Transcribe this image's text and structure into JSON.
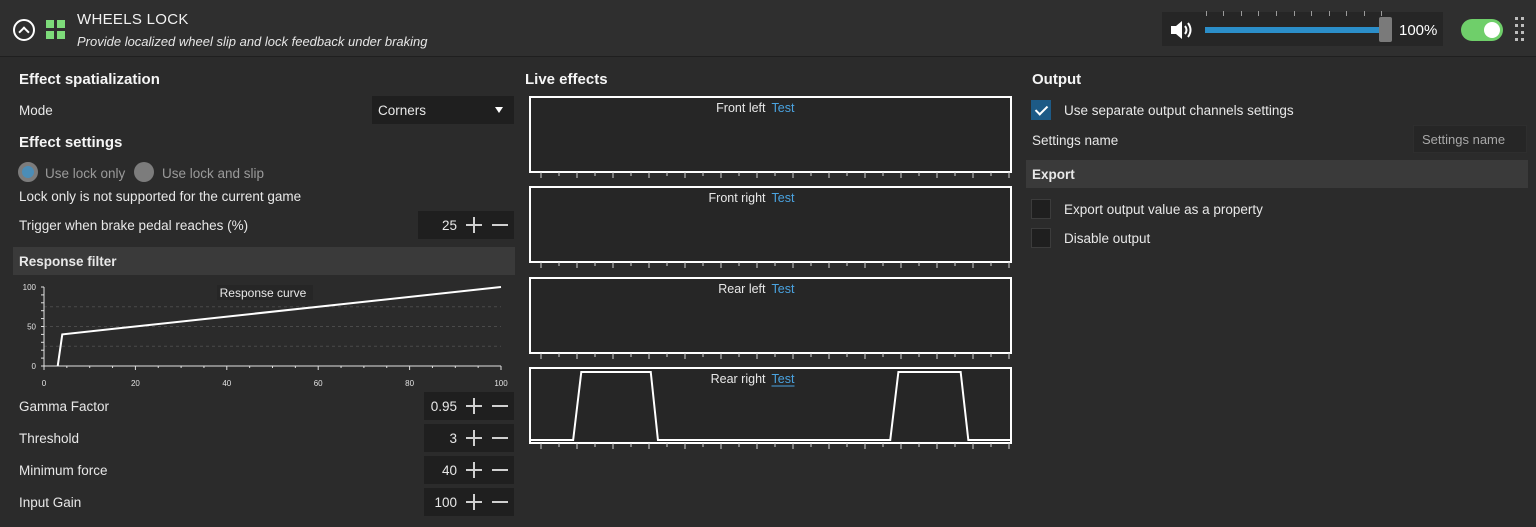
{
  "header": {
    "title": "WHEELS LOCK",
    "subtitle": "Provide localized wheel slip and lock feedback under braking",
    "volume_percent": 100,
    "volume_label": "100%",
    "enabled": true
  },
  "spatialization": {
    "title": "Effect spatialization",
    "mode_label": "Mode",
    "mode_value": "Corners"
  },
  "settings": {
    "title": "Effect settings",
    "radio_lock_only": "Use lock only",
    "radio_lock_slip": "Use lock and slip",
    "selected": "Use lock only",
    "warning": "Lock only is not supported for the current game",
    "trigger_label": "Trigger when brake pedal reaches (%)",
    "trigger_value": "25"
  },
  "response_filter": {
    "title": "Response filter",
    "curve_label": "Response curve",
    "x_ticks": [
      "0",
      "20",
      "40",
      "60",
      "80",
      "100"
    ],
    "y_ticks": [
      "100",
      "50",
      "0"
    ],
    "params": [
      {
        "label": "Gamma Factor",
        "value": "0.95"
      },
      {
        "label": "Threshold",
        "value": "3"
      },
      {
        "label": "Minimum force",
        "value": "40"
      },
      {
        "label": "Input Gain",
        "value": "100"
      }
    ]
  },
  "chart_data": {
    "type": "line",
    "title": "Response curve",
    "x": [
      3,
      4,
      100
    ],
    "y": [
      0,
      40,
      100
    ],
    "xlim": [
      0,
      100
    ],
    "ylim": [
      0,
      100
    ]
  },
  "live_effects": {
    "title": "Live effects",
    "test_label": "Test",
    "channels": [
      {
        "name": "Front left"
      },
      {
        "name": "Front right"
      },
      {
        "name": "Rear left"
      },
      {
        "name": "Rear right"
      }
    ]
  },
  "output": {
    "title": "Output",
    "separate_label": "Use separate output channels settings",
    "separate_checked": true,
    "settings_name_label": "Settings name",
    "settings_name_placeholder": "Settings name",
    "export_title": "Export",
    "export_property_label": "Export output value as a property",
    "disable_output_label": "Disable output"
  },
  "colors": {
    "background": "#2b2b2b",
    "accent_blue": "#2b8ec9",
    "toggle_green": "#6fcf6a",
    "link_blue": "#4aa3e0"
  }
}
